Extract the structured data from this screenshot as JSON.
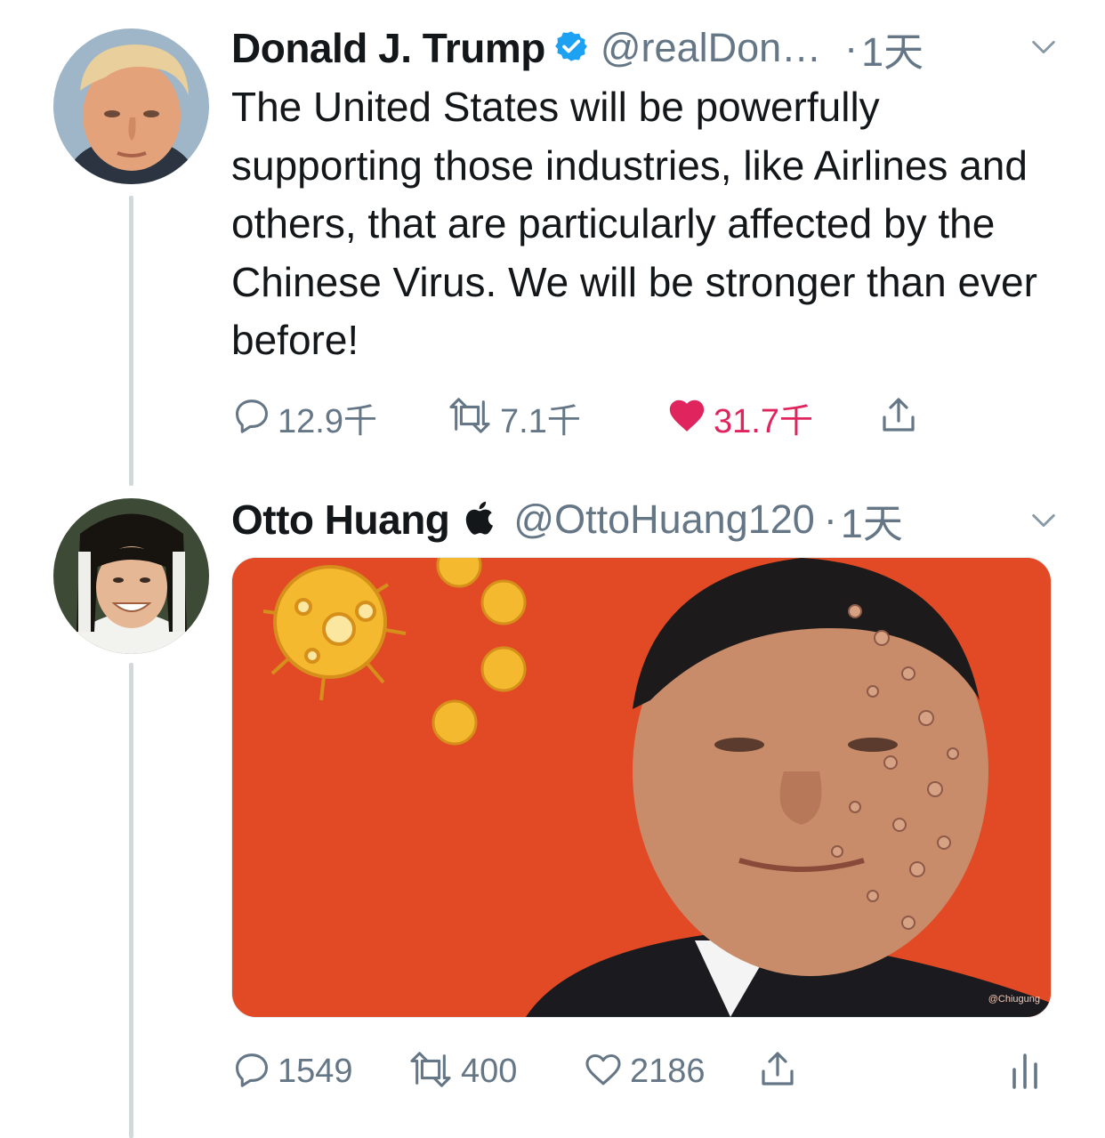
{
  "tweets": [
    {
      "name": "Donald J. Trump",
      "verified": true,
      "handle": "@realDon…",
      "separator": "·",
      "time": "1天",
      "text": "The United States will be powerfully supporting those industries, like Airlines and others, that are particularly affected by the Chinese Virus. We will be stronger than ever before!",
      "reply_count": "12.9千",
      "retweet_count": "7.1千",
      "like_count": "31.7千",
      "liked": true
    },
    {
      "name": "Otto Huang",
      "name_icon": "apple-logo-icon",
      "handle": "@OttoHuang120",
      "separator": "·",
      "time": "1天",
      "media_watermark": "@Chiugung",
      "reply_count": "1549",
      "retweet_count": "400",
      "like_count": "2186",
      "liked": false
    }
  ],
  "colors": {
    "accent_blue": "#1da1f2",
    "like_red": "#e0245e",
    "meta_gray": "#657786",
    "thread_line": "#cfd9de",
    "media_background": "#e14a24"
  }
}
